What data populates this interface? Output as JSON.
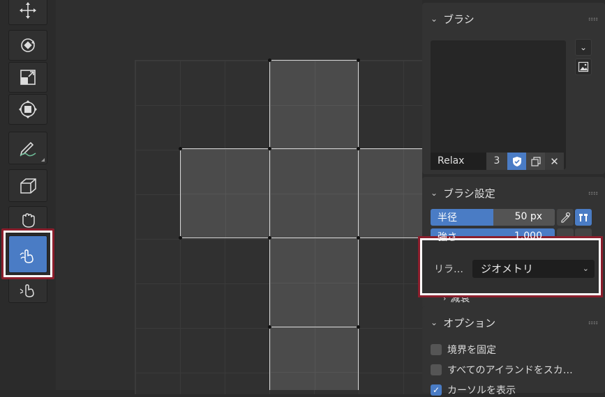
{
  "toolbar": {
    "tools": [
      {
        "name": "move-tool",
        "icon": "move-icon"
      },
      {
        "name": "rotate-tool",
        "icon": "rotate-icon"
      },
      {
        "name": "scale-tool",
        "icon": "scale-icon"
      },
      {
        "name": "transform-tool",
        "icon": "transform-icon"
      },
      {
        "name": "annotate-tool",
        "icon": "annotate-pen-icon"
      },
      {
        "name": "cursor-tool",
        "icon": "box-cursor-icon"
      },
      {
        "name": "grab-tool",
        "icon": "grab-hand-icon"
      },
      {
        "name": "relax-tool",
        "icon": "relax-hand-icon",
        "active": true
      },
      {
        "name": "pinch-tool",
        "icon": "pinch-hand-icon"
      }
    ]
  },
  "brush_panel": {
    "title": "ブラシ",
    "brush_name": "Relax",
    "user_count": "3"
  },
  "brush_settings": {
    "title": "ブラシ設定",
    "radius_label": "半径",
    "radius_value": "50 px",
    "strength_label": "強さ",
    "strength_value": "1.000"
  },
  "relax_popup": {
    "label": "リラ…",
    "selected": "ジオメトリ"
  },
  "falloff": {
    "label": "減衰"
  },
  "options": {
    "title": "オプション",
    "items": [
      {
        "label": "境界を固定",
        "checked": false
      },
      {
        "label": "すべてのアイランドをスカ…",
        "checked": false
      },
      {
        "label": "カーソルを表示",
        "checked": true
      }
    ]
  },
  "colors": {
    "accent": "#4a7cc5",
    "highlight": "#8b1e2c"
  }
}
